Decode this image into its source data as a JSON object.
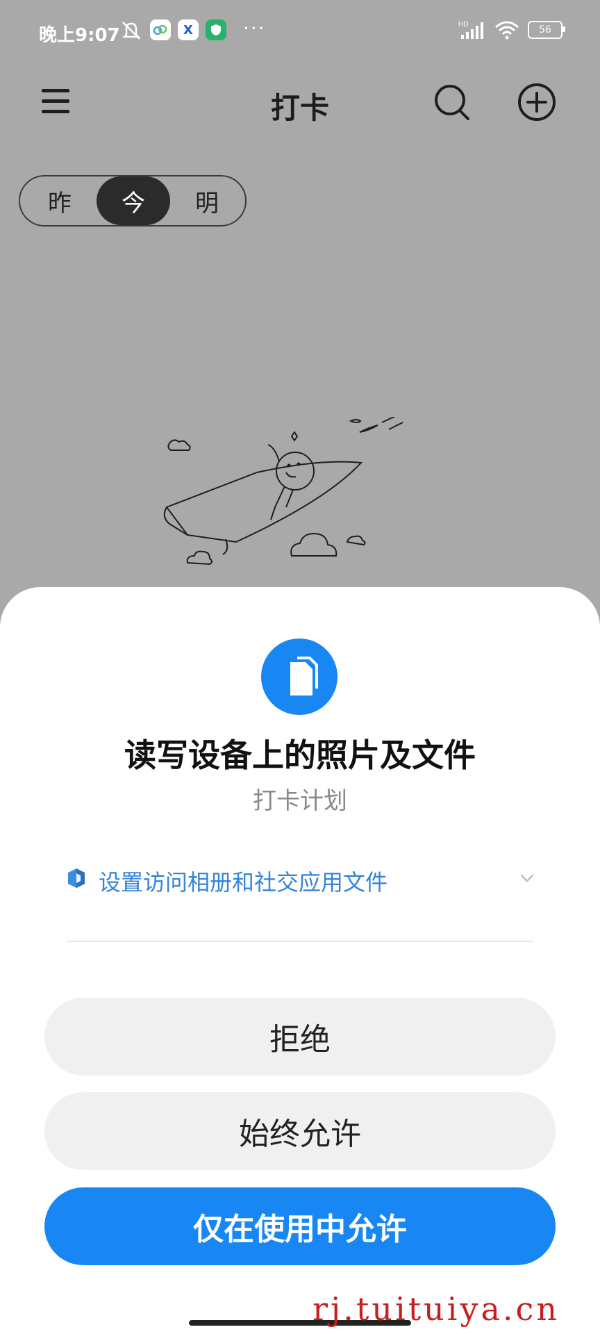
{
  "status_bar": {
    "time": "晚上9:07",
    "dots": "···",
    "app_icons": [
      "x-app-icon",
      "shield-app-icon"
    ],
    "x_app_letter": "X",
    "battery": "56",
    "network_badge": "HD"
  },
  "header": {
    "title": "打卡"
  },
  "day_tabs": [
    {
      "label": "昨",
      "active": false
    },
    {
      "label": "今",
      "active": true
    },
    {
      "label": "明",
      "active": false
    }
  ],
  "dialog": {
    "title": "读写设备上的照片及文件",
    "app_name": "打卡计划",
    "scope_link": "设置访问相册和社交应用文件",
    "buttons": {
      "deny": "拒绝",
      "always": "始终允许",
      "while_using": "仅在使用中允许"
    }
  },
  "watermark": "rj.tuituiya.cn",
  "colors": {
    "accent": "#1887f4",
    "scope_link": "#3484d8",
    "watermark": "#c81e1e",
    "overlay_background": "#a9a9a9"
  }
}
